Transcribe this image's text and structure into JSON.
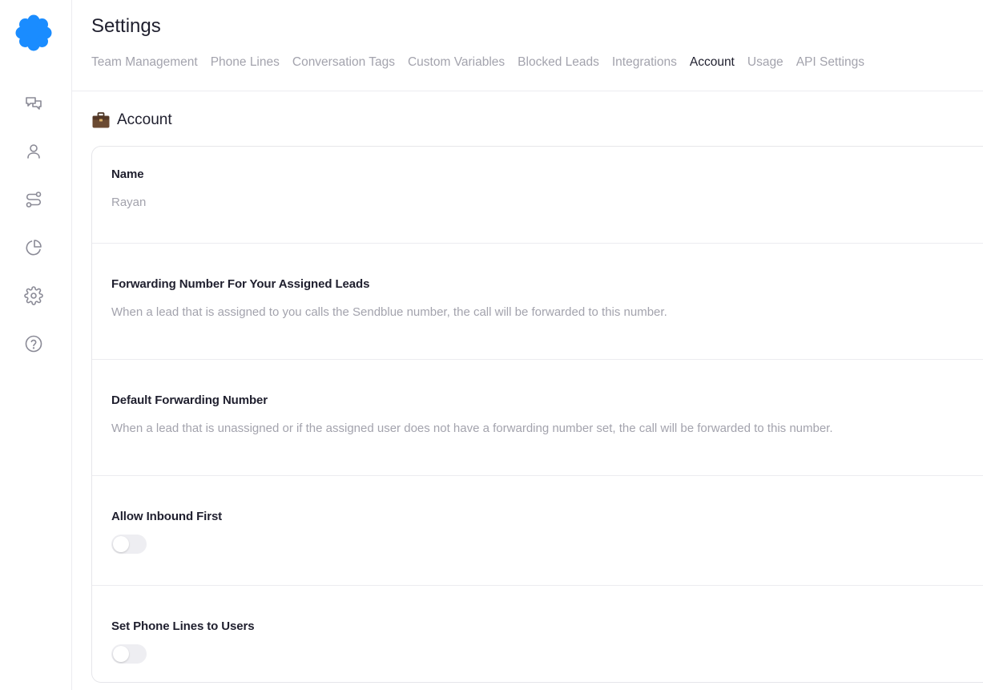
{
  "brand": {
    "accent": "#1a8cff",
    "logo_icon": "sendblue-blob-logo"
  },
  "sidebar": {
    "items": [
      {
        "icon": "chat-icon"
      },
      {
        "icon": "user-icon"
      },
      {
        "icon": "flow-icon"
      },
      {
        "icon": "pie-chart-icon"
      },
      {
        "icon": "gear-icon"
      },
      {
        "icon": "help-icon"
      }
    ]
  },
  "header": {
    "title": "Settings",
    "tabs": [
      {
        "label": "Team Management",
        "active": false
      },
      {
        "label": "Phone Lines",
        "active": false
      },
      {
        "label": "Conversation Tags",
        "active": false
      },
      {
        "label": "Custom Variables",
        "active": false
      },
      {
        "label": "Blocked Leads",
        "active": false
      },
      {
        "label": "Integrations",
        "active": false
      },
      {
        "label": "Account",
        "active": true
      },
      {
        "label": "Usage",
        "active": false
      },
      {
        "label": "API Settings",
        "active": false
      }
    ]
  },
  "account": {
    "section_title": "Account",
    "section_icon": "briefcase-icon",
    "name_label": "Name",
    "name_value": "Rayan",
    "forwarding_label": "Forwarding Number For Your Assigned Leads",
    "forwarding_desc": "When a lead that is assigned to you calls the Sendblue number, the call will be forwarded to this number.",
    "default_forwarding_label": "Default Forwarding Number",
    "default_forwarding_desc": "When a lead that is unassigned or if the assigned user does not have a forwarding number set, the call will be forwarded to this number.",
    "allow_inbound_label": "Allow Inbound First",
    "allow_inbound_on": false,
    "set_phone_lines_label": "Set Phone Lines to Users",
    "set_phone_lines_on": false
  }
}
